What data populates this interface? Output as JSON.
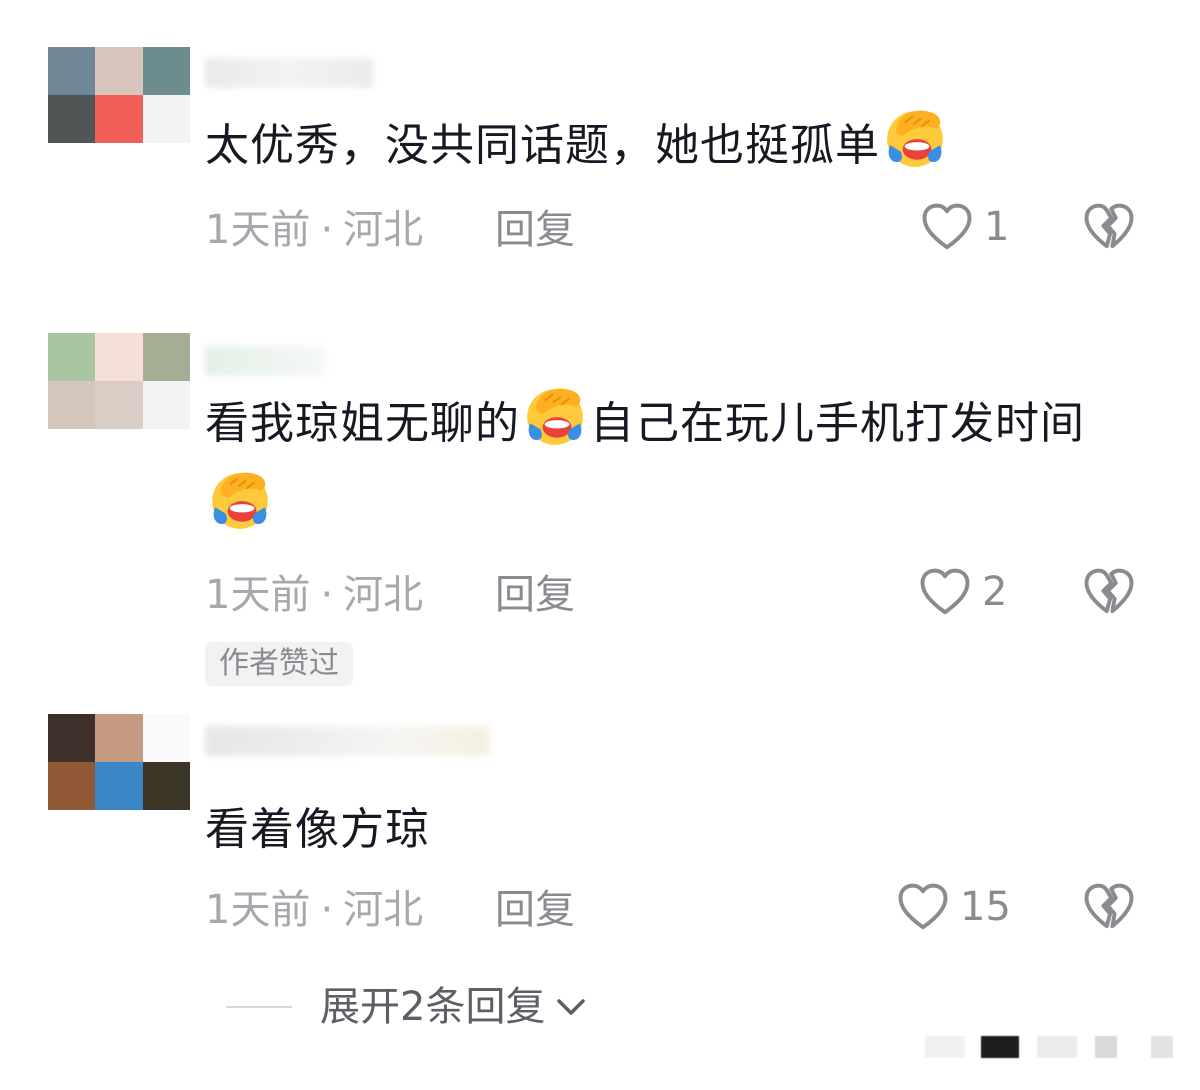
{
  "comments": [
    {
      "text_before": "太优秀，没共同话题，她也挺孤单",
      "text_after": "",
      "time": "1天前",
      "separator": "·",
      "location": "河北",
      "reply_label": "回复",
      "likes": "1",
      "emoji_icon": "face-palm-crying-emoji"
    },
    {
      "text_before": "看我琼姐无聊的",
      "text_mid": "自己在玩儿手机打发时间",
      "time": "1天前",
      "separator": "·",
      "location": "河北",
      "reply_label": "回复",
      "likes": "2",
      "badge": "作者赞过",
      "emoji_icon": "face-palm-crying-emoji"
    },
    {
      "text_before": "看着像方琼",
      "time": "1天前",
      "separator": "·",
      "location": "河北",
      "reply_label": "回复",
      "likes": "15"
    }
  ],
  "expand_replies": {
    "label": "展开2条回复"
  },
  "colors": {
    "text_primary": "#161823",
    "text_secondary": "#a7a8ad",
    "icon_gray": "#8a8b91",
    "emoji_yellow": "#ffc93c",
    "emoji_mouth": "#e8423a",
    "emoji_tear": "#3a8ee6"
  }
}
